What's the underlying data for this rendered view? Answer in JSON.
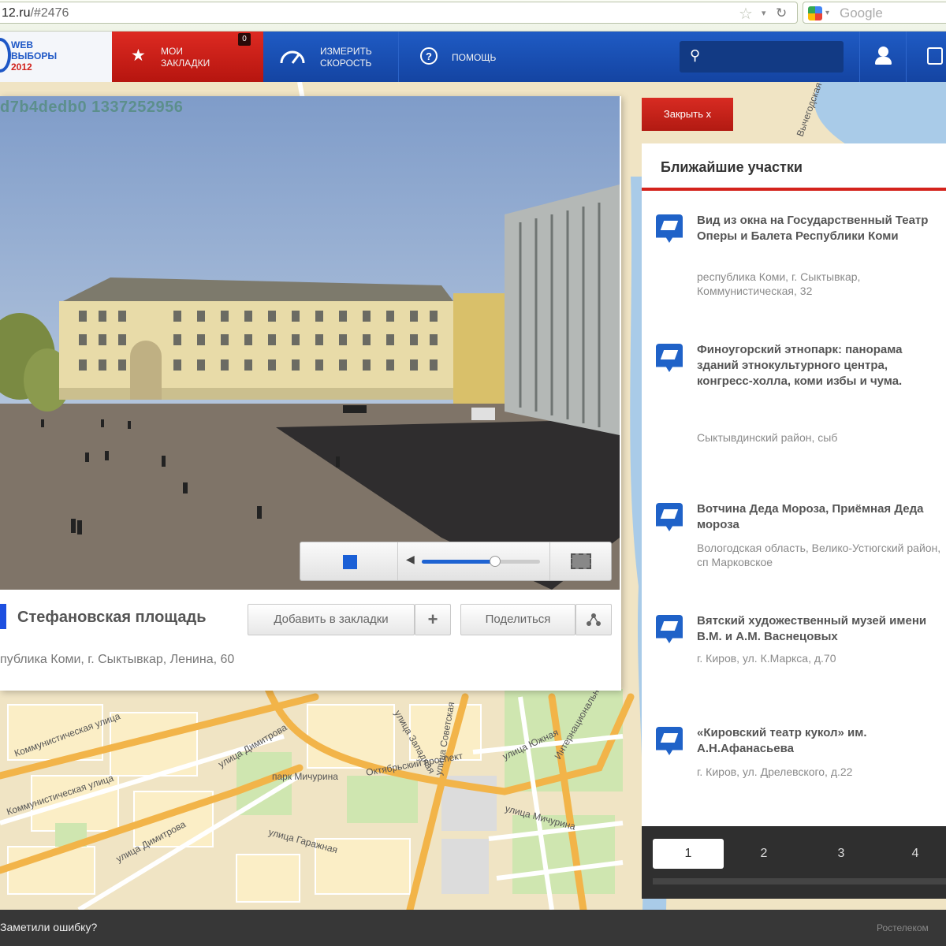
{
  "browser": {
    "url_host": "12.ru",
    "url_hash": "/#2476",
    "search_placeholder": "Google"
  },
  "header": {
    "logo": {
      "line1": "WEB",
      "line2": "ВЫБОРЫ",
      "line3": "2012"
    },
    "bookmarks": {
      "label_line1": "МОИ",
      "label_line2": "ЗАКЛАДКИ",
      "count": "0"
    },
    "speed": {
      "label_line1": "ИЗМЕРИТЬ",
      "label_line2": "СКОРОСТЬ"
    },
    "help": {
      "label": "ПОМОЩЬ"
    },
    "search_value": ""
  },
  "camera": {
    "id_text": "d7b4dedb0 1337252956",
    "title": "Стефановская площадь",
    "address": "публика Коми, г. Сыктывкар, Ленина, 60",
    "add_bookmark_label": "Добавить в закладки",
    "add_symbol": "+",
    "share_label": "Поделиться",
    "volume_level": 0.62
  },
  "sidebar": {
    "close_label": "Закрыть  x",
    "title": "Ближайшие участки",
    "items": [
      {
        "name": "Вид из окна на Государственный Театр Оперы и Балета Республики Коми",
        "address": "республика Коми, г. Сыктывкар, Коммунистическая, 32"
      },
      {
        "name": "Финоугорский этнопарк: панорама зданий этнокультурного центра, конгресс-холла, коми избы и чума.",
        "address": "Сыктывдинский район, сыб"
      },
      {
        "name": "Вотчина Деда Мороза, Приёмная Деда мороза",
        "address": "Вологодская область, Велико-Устюгский район, сп Марковское"
      },
      {
        "name": "Вятский художественный музей имени В.М. и А.М. Васнецовых",
        "address": "г. Киров, ул. К.Маркса, д.70"
      },
      {
        "name": "«Кировский театр кукол» им. А.Н.Афанасьева",
        "address": "г. Киров, ул. Дрелевского, д.22"
      }
    ],
    "pages": [
      "1",
      "2",
      "3",
      "4"
    ],
    "active_page": "1"
  },
  "map": {
    "street_labels": [
      "Коммунистическая улица",
      "Коммунистическая улица",
      "улица Димитрова",
      "улица Димитрова",
      "парк Мичурина",
      "Октябрьский проспект",
      "улица Советская",
      "улица Гаражная",
      "улица Западная",
      "улица Южная",
      "улица Мичурина",
      "Интернациональная"
    ],
    "river_label": "Вычегодская"
  },
  "footer": {
    "report_label": "Заметили ошибку?",
    "brand": "Ростелеком"
  }
}
